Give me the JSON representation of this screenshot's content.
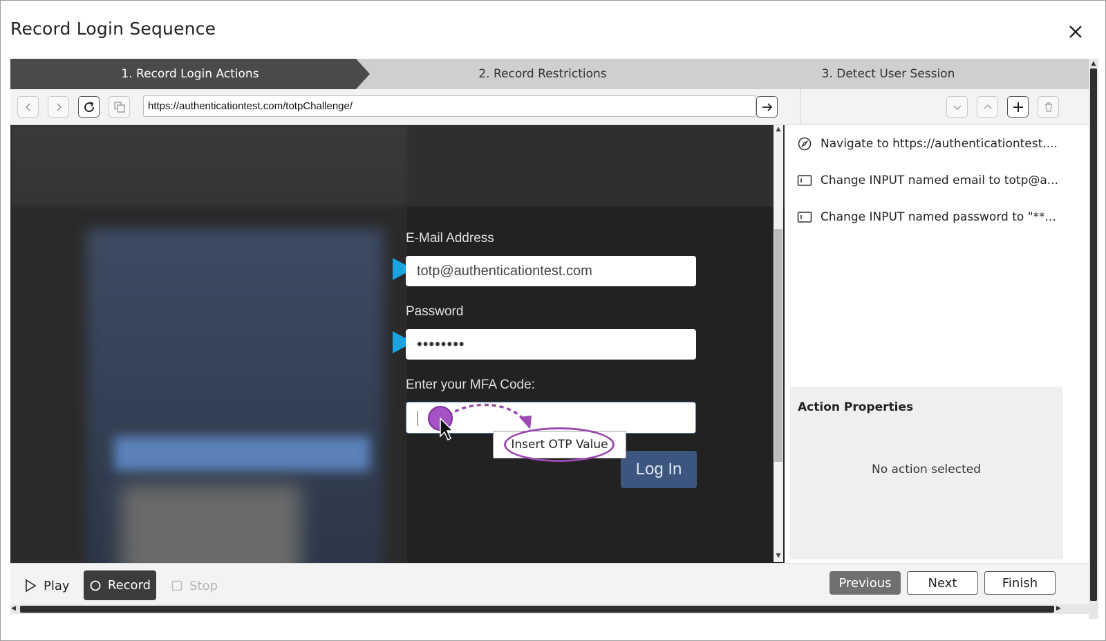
{
  "dialog": {
    "title": "Record Login Sequence",
    "close_icon": "close-icon"
  },
  "stepper": {
    "steps": [
      {
        "label": "1. Record Login Actions",
        "active": true
      },
      {
        "label": "2. Record Restrictions",
        "active": false
      },
      {
        "label": "3. Detect User Session",
        "active": false
      }
    ]
  },
  "toolbar": {
    "back_icon": "chevron-left-icon",
    "forward_icon": "chevron-right-icon",
    "reload_icon": "reload-icon",
    "copy_icon": "copy-icon",
    "url": "https://authenticationtest.com/totpChallenge/",
    "go_icon": "arrow-right-icon",
    "move_down_icon": "chevron-down-icon",
    "move_up_icon": "chevron-up-icon",
    "add_icon": "plus-icon",
    "delete_icon": "trash-icon"
  },
  "page": {
    "email_label": "E-Mail Address",
    "email_value": "totp@authenticationtest.com",
    "password_label": "Password",
    "password_value": "••••••••",
    "mfa_label": "Enter your MFA Code:",
    "login_label": "Log In",
    "otp_menu_label": "Insert OTP Value"
  },
  "actions": {
    "items": [
      {
        "icon": "compass-icon",
        "label": "Navigate to https://authenticationtest...."
      },
      {
        "icon": "input-field-icon",
        "label": "Change INPUT named email to totp@a..."
      },
      {
        "icon": "input-field-icon",
        "label": "Change INPUT named password to \"**..."
      }
    ],
    "properties_title": "Action Properties",
    "properties_empty": "No action selected"
  },
  "bottom": {
    "play_label": "Play",
    "record_label": "Record",
    "stop_label": "Stop",
    "previous_label": "Previous",
    "next_label": "Next",
    "finish_label": "Finish"
  },
  "colors": {
    "accent_marker": "#1aa3e0",
    "otp_highlight": "#9a4ab0",
    "login_button": "#3c5680",
    "active_step": "#4a4a4a"
  }
}
